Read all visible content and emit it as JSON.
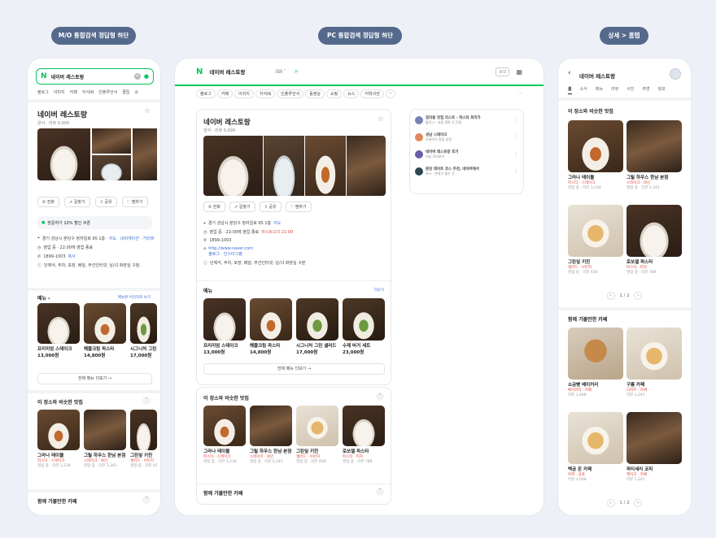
{
  "labels": {
    "mobile": "M/O 통합검색 정답형 하단",
    "pc": "PC 통합검색 정답형 하단",
    "detail": "상세 > 홈탭"
  },
  "search": {
    "query": "네이버 레스토랑",
    "tabs_mobile": [
      "블로그",
      "이미지",
      "카페",
      "지식iN",
      "인플루언서",
      "클립",
      "쇼"
    ],
    "tabs_pc": [
      "블로그",
      "카페",
      "이미지",
      "지식iN",
      "인플루언서",
      "동영상",
      "쇼핑",
      "뉴스",
      "어학사전"
    ],
    "logo": "N"
  },
  "place": {
    "name": "네이버 레스토랑",
    "meta_mobile": "양식 · 리뷰 9,999",
    "meta_pc": "양식 · 리뷰 9,999",
    "actions": [
      "전화",
      "길찾기",
      "공유",
      "찜하기"
    ],
    "notice": "방문하기 10% 할인 쿠폰",
    "address": "경기 성남시 분당구 정자일로 95 1층",
    "address_link": "지도 · 내비게이션 · 거리뷰",
    "hours": "영업 중 · 22:00에 영업 종료",
    "phone": "1899-1003",
    "phone_link": "복사",
    "amenities": "단체석, 주차, 포장, 배달, 무선인터넷, 남/녀 화장실 구분,",
    "pc_address": "경기 성남시 분당구 정자일로 95 1층",
    "pc_address_link": "지도",
    "pc_hours": "영업 중 · 22:00에 영업 종료",
    "pc_hours_extra": "라스트오더 21:00",
    "pc_phone": "1899-1003",
    "pc_url": "http://www.naver.com",
    "pc_url_links": "블로그 · 인스타그램",
    "pc_amenities": "단체석, 주차, 포장, 배달, 무선인터넷, 남/녀 화장실 구분"
  },
  "menu": {
    "title": "메뉴",
    "more_mobile": "메뉴판 이미지로 보기",
    "more_pc": "더보기",
    "items": [
      {
        "name": "프리미엄 스테이크",
        "price": "13,000원"
      },
      {
        "name": "해물크림 파스타",
        "price": "14,800원"
      },
      {
        "name": "시그니처 그린 샐러드",
        "price": "17,000원"
      },
      {
        "name": "수제 버거 세트",
        "price": "23,000원"
      }
    ],
    "more_button": "전체 메뉴 더보기"
  },
  "similar": {
    "title": "이 장소와 비슷한 맛집",
    "title_detail": "이 장소와 비슷한 맛집",
    "items": [
      {
        "name": "그라나 테이블",
        "tag": "파스타 · 스테이크",
        "meta": "영업 중 · 리뷰 1,234"
      },
      {
        "name": "그릴 하우스 한남 본점",
        "tag": "스테이크 · 와인",
        "meta": "영업 중 · 리뷰 2,341"
      },
      {
        "name": "그린잎 키친",
        "tag": "샐러드 · 브런치",
        "meta": "영업 중 · 리뷰 456"
      },
      {
        "name": "로쏘델 파스타",
        "tag": "파스타 · 피자",
        "meta": "영업 중 · 리뷰 789"
      }
    ],
    "pager": "1 / 2"
  },
  "cafes": {
    "title": "함께 가볼만한 카페",
    "items": [
      {
        "name": "소금빵 베이커리",
        "tag": "베이커리 · 카페",
        "meta": "리뷰 1,048"
      },
      {
        "name": "구름 카페",
        "tag": "디저트 · 카페",
        "meta": "리뷰 1,241"
      },
      {
        "name": "백금 온 카페",
        "tag": "커피 · 음료",
        "meta": "리뷰 1,048"
      },
      {
        "name": "파티세리 코피",
        "tag": "케이크 · 카페",
        "meta": "리뷰 1,241"
      }
    ],
    "pager": "1 / 2"
  },
  "pc_related": [
    {
      "title": "정자동 맛집 리스트 - 파스타 최저가",
      "sub": "블로그 · 요즘 핫한 곳 모음"
    },
    {
      "title": "성남 스테이크",
      "sub": "스테이크 맛집 추천"
    },
    {
      "title": "네이버 레스토랑 후기",
      "sub": "리뷰 모아보기"
    },
    {
      "title": "분당 데이트 코스 추천, 네이버에서",
      "sub": "코스 · 분위기 좋은 곳"
    }
  ],
  "detail": {
    "title": "네이버 레스토랑",
    "tabs": [
      "홈",
      "소식",
      "메뉴",
      "리뷰",
      "사진",
      "주변",
      "정보",
      "예약"
    ]
  },
  "colors": {
    "brand": "#03c75a",
    "pill": "#55698c",
    "alert": "#e0473b"
  }
}
